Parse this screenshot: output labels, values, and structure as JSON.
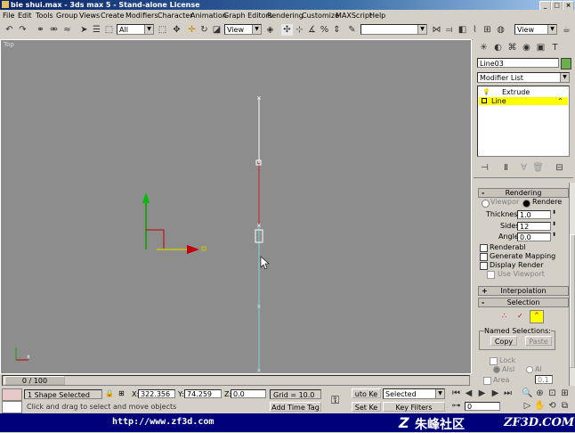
{
  "window": {
    "title": "bie shui.max - 3ds max 5 - Stand-alone License"
  },
  "menu": [
    "File",
    "Edit",
    "Tools",
    "Group",
    "Views",
    "Create",
    "Modifiers",
    "Character",
    "Animation",
    "Graph Editors",
    "Rendering",
    "Customize",
    "MAXScript",
    "Help"
  ],
  "toolbar": {
    "selection_filter": "All",
    "ref_coord": "View",
    "ref_coord2": "View"
  },
  "viewport": {
    "label": "Top"
  },
  "command_panel": {
    "object_name": "Line03",
    "modifier_list": "Modifier List",
    "stack": [
      "Extrude",
      "Line"
    ],
    "rendering": {
      "title": "Rendering",
      "viewport_label": "Viewpor",
      "renderer_label": "Rendere",
      "thickness_label": "Thickness:",
      "thickness": "1.0",
      "sides_label": "Sides:",
      "sides": "12",
      "angle_label": "Angle:",
      "angle": "0.0",
      "renderable": "Renderabl",
      "gen_mapping": "Generate Mapping",
      "display_render": "Display Render",
      "use_viewport": "Use Viewport"
    },
    "interpolation": {
      "title": "Interpolation"
    },
    "selection": {
      "title": "Selection",
      "named_sel": "Named Selections:",
      "copy": "Copy",
      "paste": "Paste",
      "lock": "Lock",
      "by_vertex": "Alsl",
      "al": "Al",
      "area": "Area",
      "area_val": "0.1"
    }
  },
  "status": {
    "time_slider": "0 / 100",
    "selected_text": "1 Shape Selected",
    "x_label": "X:",
    "x": "322.356",
    "y_label": "Y:",
    "y": "74.259",
    "z_label": "Z:",
    "z": "0.0",
    "grid": "Grid = 10.0",
    "auto_key": "uto Ke",
    "set_key": "Set Ke",
    "selected_dd": "Selected",
    "key_filters": "Key Filters",
    "prompt": "Click and drag to select and move objects",
    "add_time_tag": "Add Time Tag",
    "frame": "0"
  },
  "footer": {
    "url": "http://www.zf3d.com",
    "brand_cn": "朱峰社区",
    "brand_en": "ZF3D.COM"
  },
  "colors": {
    "viewport_bg": "#8d8d8d",
    "selected_modifier": "#ffff00",
    "spline_white": "#ffffff",
    "spline_red": "#cc2222",
    "spline_cyan": "#7fd6d6"
  }
}
